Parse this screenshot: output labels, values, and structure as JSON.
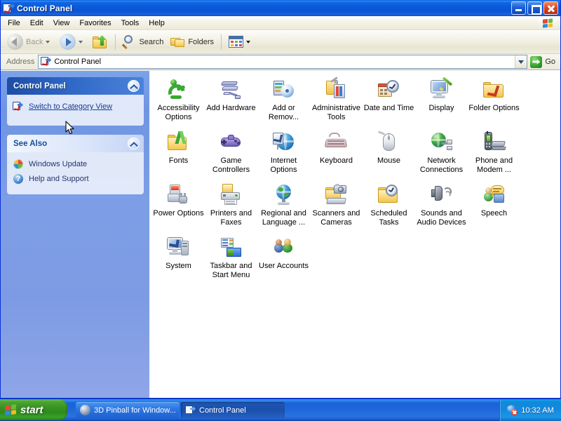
{
  "window": {
    "title": "Control Panel",
    "title_icon": "control-panel-icon",
    "buttons": {
      "minimize": "Minimize",
      "maximize": "Maximize",
      "close": "Close"
    }
  },
  "menubar": {
    "items": [
      {
        "label": "File"
      },
      {
        "label": "Edit"
      },
      {
        "label": "View"
      },
      {
        "label": "Favorites"
      },
      {
        "label": "Tools"
      },
      {
        "label": "Help"
      }
    ],
    "logo": "windows-flag-icon"
  },
  "toolbar": {
    "back_label": "Back",
    "forward_label": "",
    "up_label": "",
    "search_label": "Search",
    "folders_label": "Folders",
    "views_label": ""
  },
  "addressbar": {
    "label": "Address",
    "value": "Control Panel",
    "icon": "control-panel-icon",
    "go_label": "Go"
  },
  "sidebar": {
    "panels": [
      {
        "title": "Control Panel",
        "style": "dark",
        "links": [
          {
            "label": "Switch to Category View",
            "icon": "category-view-icon",
            "hovered": true
          }
        ]
      },
      {
        "title": "See Also",
        "style": "light",
        "links": [
          {
            "label": "Windows Update",
            "icon": "windows-update-icon",
            "hovered": false
          },
          {
            "label": "Help and Support",
            "icon": "help-support-icon",
            "hovered": false
          }
        ]
      }
    ]
  },
  "content": {
    "items": [
      {
        "label": "Accessibility Options",
        "icon": "accessibility-icon"
      },
      {
        "label": "Add Hardware",
        "icon": "add-hardware-icon"
      },
      {
        "label": "Add or Remov...",
        "icon": "add-remove-programs-icon"
      },
      {
        "label": "Administrative Tools",
        "icon": "administrative-tools-icon"
      },
      {
        "label": "Date and Time",
        "icon": "date-time-icon"
      },
      {
        "label": "Display",
        "icon": "display-icon"
      },
      {
        "label": "Folder Options",
        "icon": "folder-options-icon"
      },
      {
        "label": "Fonts",
        "icon": "fonts-icon"
      },
      {
        "label": "Game Controllers",
        "icon": "game-controllers-icon"
      },
      {
        "label": "Internet Options",
        "icon": "internet-options-icon"
      },
      {
        "label": "Keyboard",
        "icon": "keyboard-icon"
      },
      {
        "label": "Mouse",
        "icon": "mouse-icon"
      },
      {
        "label": "Network Connections",
        "icon": "network-connections-icon"
      },
      {
        "label": "Phone and Modem ...",
        "icon": "phone-modem-icon"
      },
      {
        "label": "Power Options",
        "icon": "power-options-icon"
      },
      {
        "label": "Printers and Faxes",
        "icon": "printers-faxes-icon"
      },
      {
        "label": "Regional and Language ...",
        "icon": "regional-language-icon"
      },
      {
        "label": "Scanners and Cameras",
        "icon": "scanners-cameras-icon"
      },
      {
        "label": "Scheduled Tasks",
        "icon": "scheduled-tasks-icon"
      },
      {
        "label": "Sounds and Audio Devices",
        "icon": "sounds-audio-icon"
      },
      {
        "label": "Speech",
        "icon": "speech-icon"
      },
      {
        "label": "System",
        "icon": "system-icon"
      },
      {
        "label": "Taskbar and Start Menu",
        "icon": "taskbar-start-menu-icon"
      },
      {
        "label": "User Accounts",
        "icon": "user-accounts-icon"
      }
    ]
  },
  "taskbar": {
    "start_label": "start",
    "tasks": [
      {
        "label": "3D Pinball for Window...",
        "icon": "pinball-icon",
        "active": false
      },
      {
        "label": "Control Panel",
        "icon": "control-panel-icon",
        "active": true
      }
    ],
    "tray": {
      "icon": "security-alert-icon",
      "clock": "10:32 AM"
    }
  },
  "colors": {
    "titlebar_blue": "#0a5ad8",
    "taskbar_blue": "#1e66d9",
    "start_green": "#399323",
    "sidebar_blue": "#7d9ee6",
    "panel_header_dark": "#1d4ea8",
    "link_blue": "#1a3a8f",
    "close_red": "#de4b22"
  }
}
